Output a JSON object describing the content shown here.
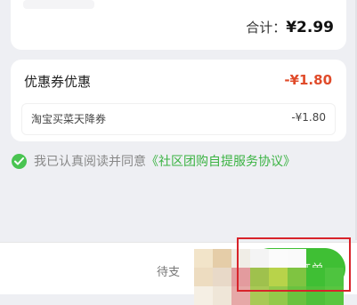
{
  "summary": {
    "total_label": "合计：",
    "total_value": "¥2.99"
  },
  "coupon": {
    "title": "优惠券优惠",
    "total": "-¥1.80",
    "items": [
      {
        "name": "淘宝买菜天降券",
        "value": "-¥1.80"
      }
    ]
  },
  "agreement": {
    "text": "我已认真阅读并同意",
    "link": "《社区团购自提服务协议》",
    "checked": true
  },
  "footer": {
    "pay_label": "待支",
    "submit_label": "提交订单"
  },
  "colors": {
    "accent_green": "#3fbf34",
    "discount_red": "#e04b2a",
    "highlight_red": "#d8232a",
    "page_background": "#eeeff3"
  }
}
